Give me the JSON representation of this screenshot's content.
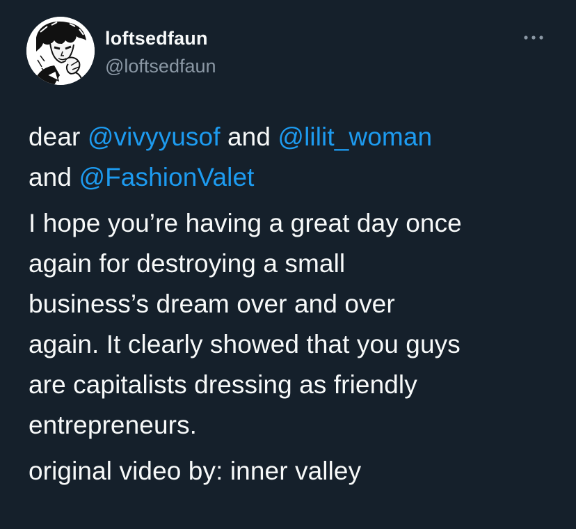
{
  "author": {
    "display_name": "loftsedfaun",
    "handle": "@loftsedfaun"
  },
  "tweet": {
    "intro": {
      "word_dear": "dear",
      "mention_1": "@vivyyusof",
      "word_and_1": "and",
      "mention_2": "@lilit_woman",
      "word_and_2": "and",
      "mention_3": "@FashionValet"
    },
    "paragraph_1_lines": [
      "I hope you’re having a great day once",
      "again for destroying a small",
      "business’s dream over and over",
      "again. It clearly showed that you guys",
      "are capitalists dressing as friendly",
      "entrepreneurs."
    ],
    "paragraph_2": "original video by: inner valley"
  },
  "icons": {
    "more": "more-horizontal-icon",
    "avatar": "avatar-illustration"
  },
  "colors": {
    "background": "#15202b",
    "text": "#f7f9f9",
    "secondary_text": "#8b98a5",
    "link": "#1d9bf0"
  }
}
